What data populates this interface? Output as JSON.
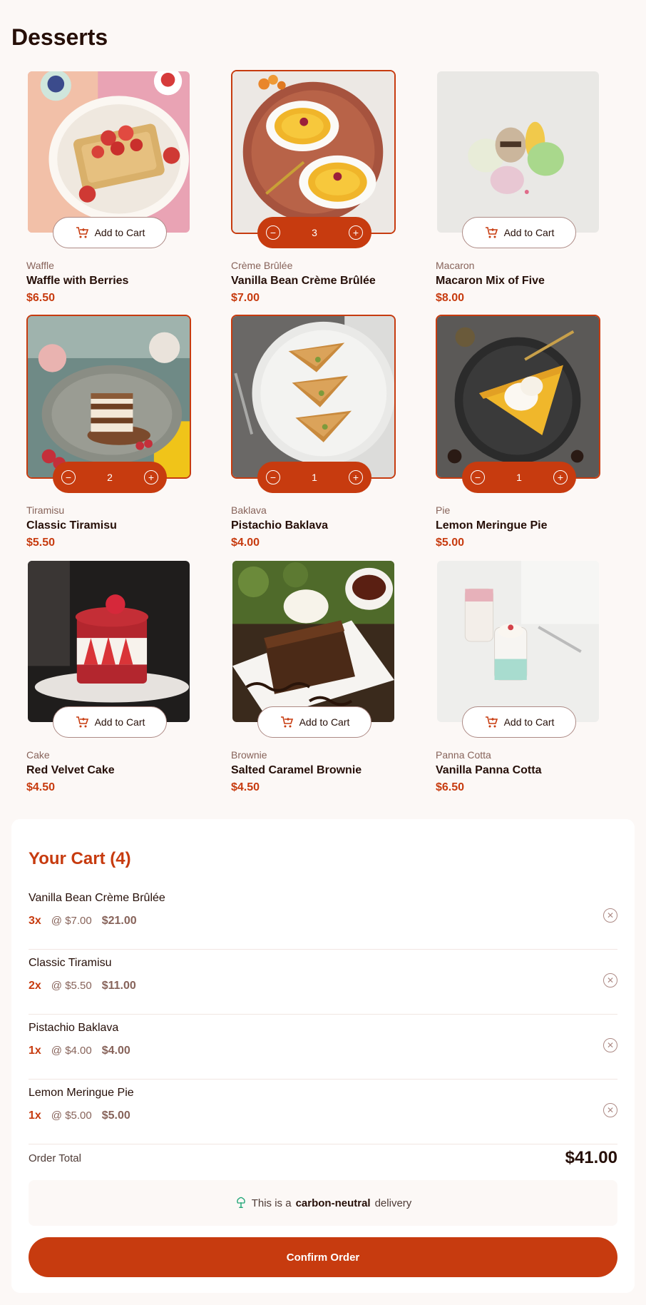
{
  "page": {
    "title": "Desserts"
  },
  "colors": {
    "accent": "#c73b0f",
    "text": "#260f08",
    "muted": "#87635a",
    "background": "#fcf8f6"
  },
  "add_to_cart_label": "Add to Cart",
  "products": [
    {
      "category": "Waffle",
      "name": "Waffle with Berries",
      "price": "$6.50",
      "in_cart": false,
      "quantity": ""
    },
    {
      "category": "Crème Brûlée",
      "name": "Vanilla Bean Crème Brûlée",
      "price": "$7.00",
      "in_cart": true,
      "quantity": "3"
    },
    {
      "category": "Macaron",
      "name": "Macaron Mix of Five",
      "price": "$8.00",
      "in_cart": false,
      "quantity": ""
    },
    {
      "category": "Tiramisu",
      "name": "Classic Tiramisu",
      "price": "$5.50",
      "in_cart": true,
      "quantity": "2"
    },
    {
      "category": "Baklava",
      "name": "Pistachio Baklava",
      "price": "$4.00",
      "in_cart": true,
      "quantity": "1"
    },
    {
      "category": "Pie",
      "name": "Lemon Meringue Pie",
      "price": "$5.00",
      "in_cart": true,
      "quantity": "1"
    },
    {
      "category": "Cake",
      "name": "Red Velvet Cake",
      "price": "$4.50",
      "in_cart": false,
      "quantity": ""
    },
    {
      "category": "Brownie",
      "name": "Salted Caramel Brownie",
      "price": "$4.50",
      "in_cart": false,
      "quantity": ""
    },
    {
      "category": "Panna Cotta",
      "name": "Vanilla Panna Cotta",
      "price": "$6.50",
      "in_cart": false,
      "quantity": ""
    }
  ],
  "cart": {
    "title": "Your Cart (4)",
    "items": [
      {
        "name": "Vanilla Bean Crème Brûlée",
        "qty": "3x",
        "unit": "@ $7.00",
        "subtotal": "$21.00"
      },
      {
        "name": "Classic Tiramisu",
        "qty": "2x",
        "unit": "@ $5.50",
        "subtotal": "$11.00"
      },
      {
        "name": "Pistachio Baklava",
        "qty": "1x",
        "unit": "@ $4.00",
        "subtotal": "$4.00"
      },
      {
        "name": "Lemon Meringue Pie",
        "qty": "1x",
        "unit": "@ $5.00",
        "subtotal": "$5.00"
      }
    ],
    "total_label": "Order Total",
    "total_value": "$41.00",
    "carbon_prefix": "This is a",
    "carbon_bold": "carbon-neutral",
    "carbon_suffix": "delivery",
    "confirm_label": "Confirm Order"
  }
}
